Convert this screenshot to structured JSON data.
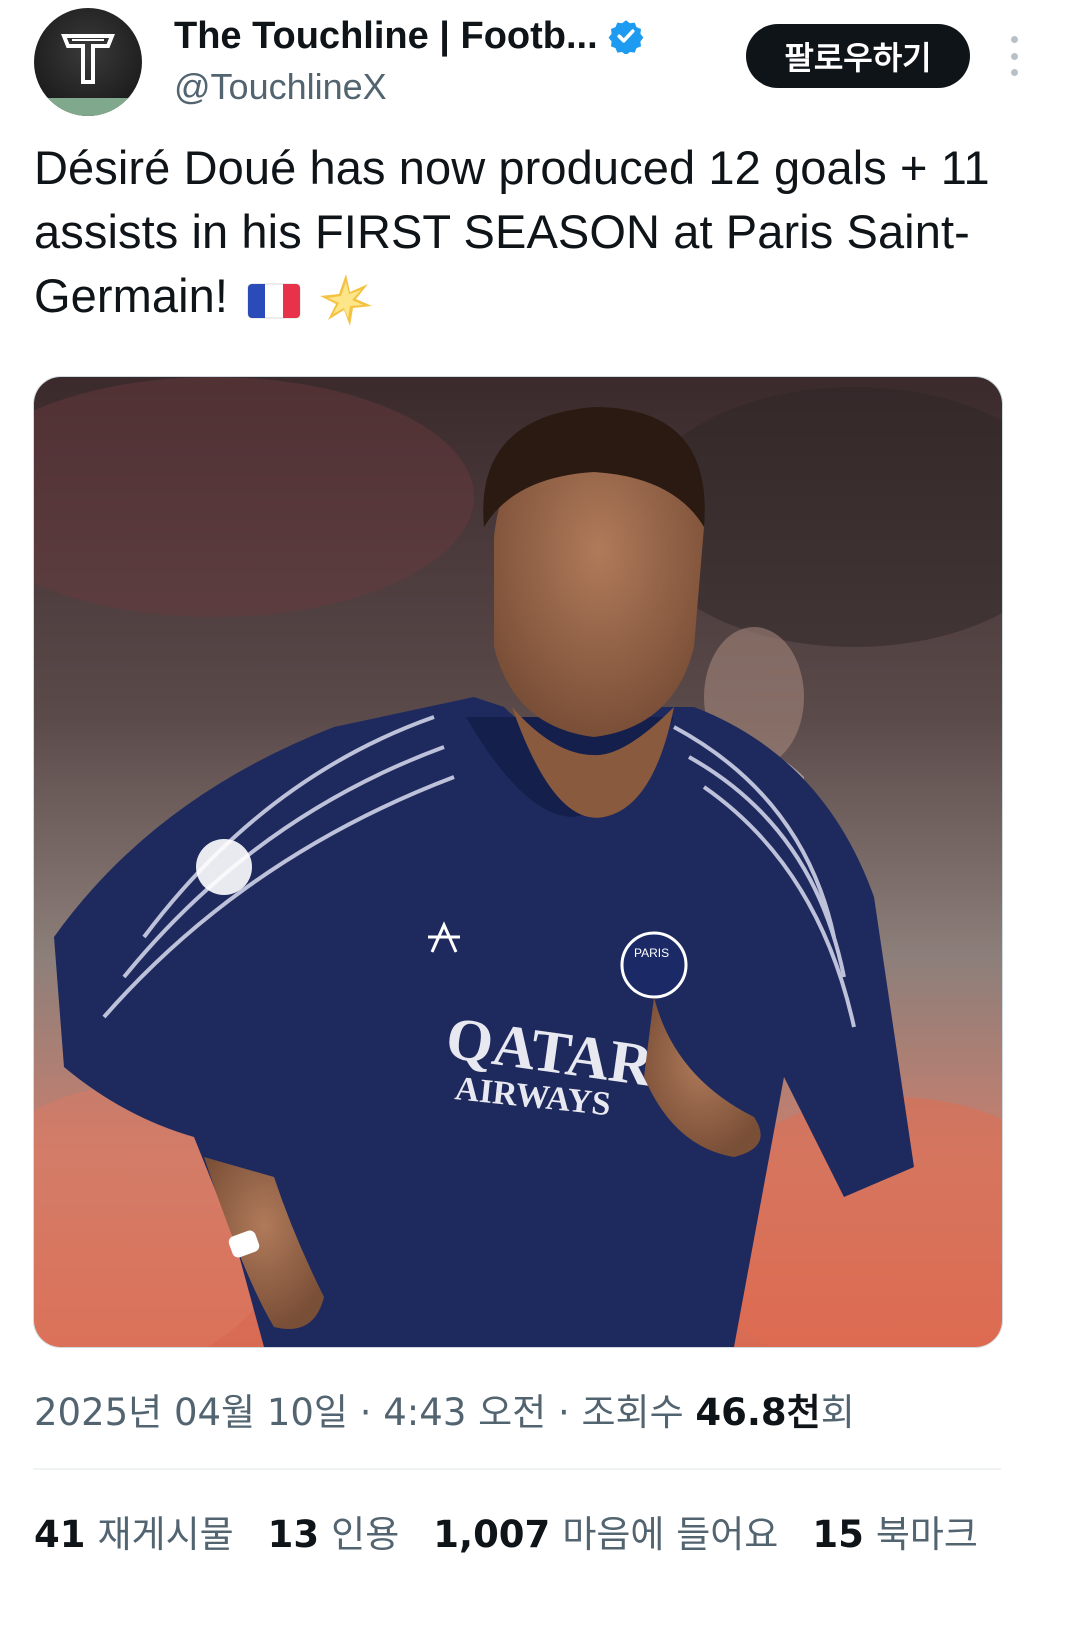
{
  "header": {
    "display_name": "The Touchline | Footb...",
    "handle": "@TouchlineX",
    "follow_label": "팔로우하기",
    "verified_color": "#1d9bf0"
  },
  "tweet": {
    "text": "Désiré Doué has now produced 12 goals + 11 assists in his FIRST SEASON at Paris Saint-Germain!",
    "emojis": [
      "flag-france-icon",
      "glowing-star-icon"
    ],
    "media": {
      "jersey_sponsor": "QATAR",
      "jersey_sponsor_sub": "AIRWAYS",
      "jersey_crest": "PARIS"
    }
  },
  "meta": {
    "date": "2025년 04월 10일",
    "time": "4:43 오전",
    "views_label": "조회수",
    "views_count": "46.8천",
    "views_suffix": "회",
    "separator": "·"
  },
  "stats": [
    {
      "count": "41",
      "label": "재게시물"
    },
    {
      "count": "13",
      "label": "인용"
    },
    {
      "count": "1,007",
      "label": "마음에 들어요"
    },
    {
      "count": "15",
      "label": "북마크"
    }
  ]
}
